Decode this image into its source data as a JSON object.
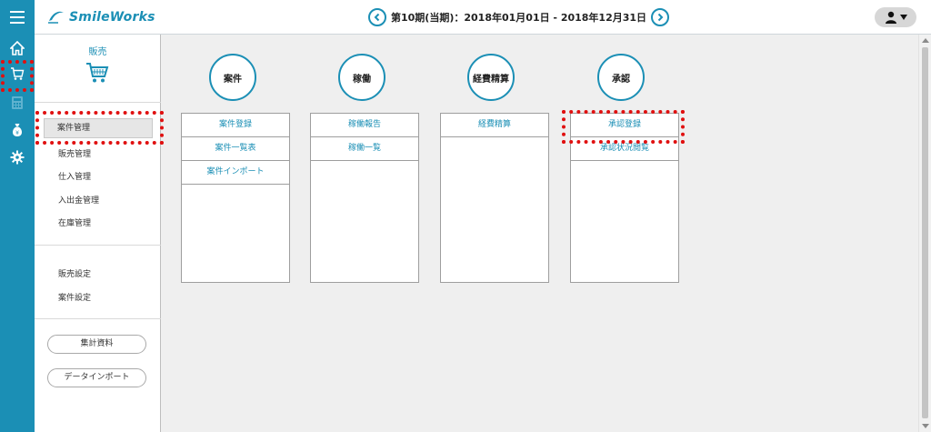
{
  "app": {
    "logo_text": "SmileWorks",
    "period_text": "第10期(当期)：2018年01月01日 - 2018年12月31日"
  },
  "rail": {
    "items": [
      {
        "icon": "home-icon"
      },
      {
        "icon": "cart-icon"
      },
      {
        "icon": "calculator-icon"
      },
      {
        "icon": "money-bag-icon"
      },
      {
        "icon": "gear-icon"
      }
    ]
  },
  "sidebar": {
    "section_title": "販売",
    "items": [
      {
        "label": "案件管理",
        "active": true
      },
      {
        "label": "販売管理"
      },
      {
        "label": "仕入管理"
      },
      {
        "label": "入出金管理"
      },
      {
        "label": "在庫管理"
      }
    ],
    "settings": [
      {
        "label": "販売設定"
      },
      {
        "label": "案件設定"
      }
    ],
    "buttons": [
      {
        "label": "集計資料"
      },
      {
        "label": "データインポート"
      }
    ]
  },
  "columns": [
    {
      "title": "案件",
      "links": [
        {
          "label": "案件登録"
        },
        {
          "label": "案件一覧表"
        },
        {
          "label": "案件インポート"
        }
      ]
    },
    {
      "title": "稼働",
      "links": [
        {
          "label": "稼働報告"
        },
        {
          "label": "稼働一覧"
        }
      ]
    },
    {
      "title": "経費精算",
      "links": [
        {
          "label": "経費精算"
        }
      ]
    },
    {
      "title": "承認",
      "links": [
        {
          "label": "承認登録"
        },
        {
          "label": "承認状況閲覧"
        }
      ]
    }
  ],
  "colors": {
    "brand": "#1b8fb5",
    "highlight": "#e01010",
    "main_bg": "#efefef"
  }
}
